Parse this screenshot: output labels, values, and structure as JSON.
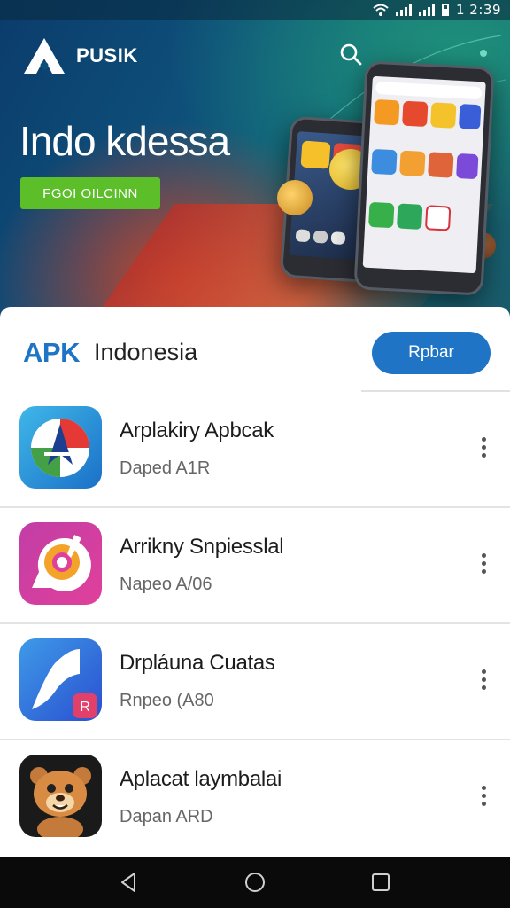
{
  "status_bar": {
    "time": "1 2:39"
  },
  "brand": {
    "name": "PUSIK",
    "mark": "A"
  },
  "hero": {
    "title": "Indo kdessa",
    "cta_label": "FGOI OILCINN"
  },
  "section": {
    "title_part1": "APK",
    "title_part2": "Indonesia",
    "action_label": "Rpbar"
  },
  "apps": [
    {
      "name": "Arplakiry Apbcak",
      "subtitle": "Daped A1R",
      "icon": "compass-app-icon"
    },
    {
      "name": "Arrikny Snpiesslal",
      "subtitle": "Napeo A/06",
      "icon": "camera-app-icon"
    },
    {
      "name": "Drpláuna Cuatas",
      "subtitle": "Rnpeo (A80",
      "icon": "music-app-icon"
    },
    {
      "name": "Aplacat laymbalai",
      "subtitle": "Dapan ARD",
      "icon": "bear-app-icon"
    }
  ],
  "colors": {
    "accent": "#1f74c6",
    "cta_green": "#5cbf2a"
  }
}
